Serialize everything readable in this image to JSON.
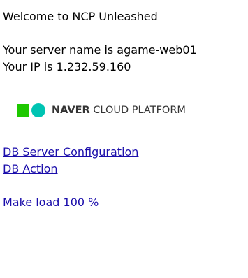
{
  "welcome": "Welcome to NCP Unleashed",
  "server_name_line": "Your server name is agame-web01",
  "server_ip_line": "Your IP is 1.232.59.160",
  "logo": {
    "brand": "NAVER",
    "rest": " CLOUD PLATFORM",
    "colors": {
      "square": "#1ec800",
      "circle": "#00c4b3",
      "text": "#333333"
    }
  },
  "links": {
    "db_config": "DB Server Configuration",
    "db_action": "DB Action",
    "make_load": "Make load 100 %"
  },
  "colors": {
    "link": "#1a0dab",
    "text": "#000000",
    "background": "#ffffff"
  }
}
